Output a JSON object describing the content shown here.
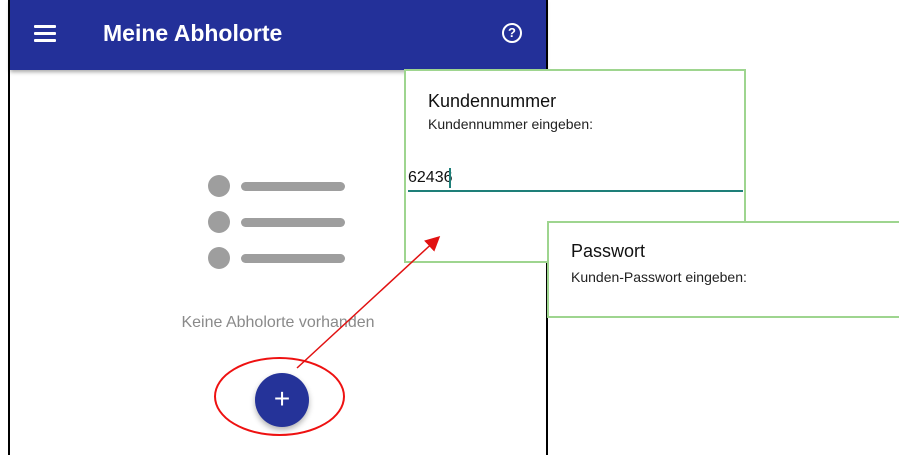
{
  "app": {
    "title": "Meine Abholorte",
    "help_icon_glyph": "?",
    "empty_state_text": "Keine Abholorte vorhanden",
    "fab_glyph": "+",
    "colors": {
      "appbar": "#233099",
      "fab": "#253399",
      "highlight": "#e11111"
    }
  },
  "dialogs": {
    "customer": {
      "title": "Kundennummer",
      "subtitle": "Kundennummer eingeben:",
      "value": "62436"
    },
    "password": {
      "title": "Passwort",
      "subtitle": "Kunden-Passwort eingeben:"
    },
    "border_color": "#9ed58f"
  },
  "icons": {
    "menu": "hamburger-menu-icon",
    "help": "help-circle-icon",
    "empty": "list-placeholder-icon",
    "add": "plus-icon"
  }
}
